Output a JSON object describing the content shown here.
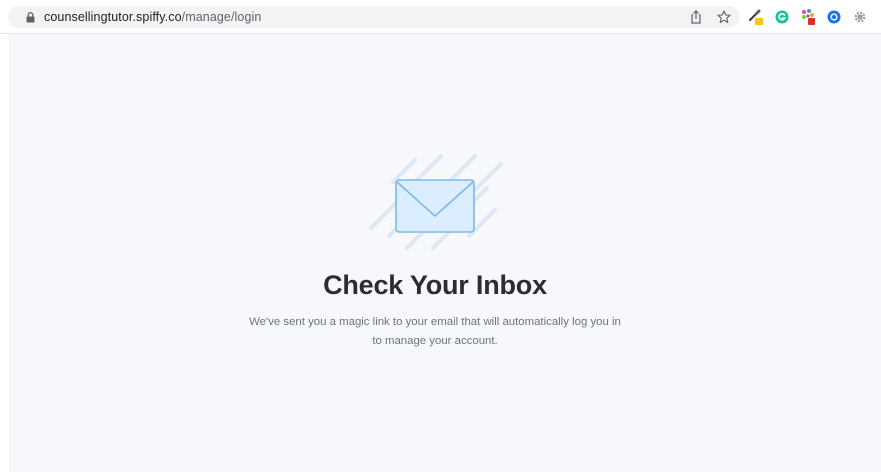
{
  "browser": {
    "url_domain": "counsellingtutor.spiffy.co",
    "url_path": "/manage/login",
    "icons": {
      "lock": "lock-icon",
      "share": "share-icon",
      "bookmark": "bookmark-star-icon"
    },
    "extensions": [
      "eyedropper-extension-icon",
      "grammarly-extension-icon",
      "colorful-extension-icon",
      "blue-circle-extension-icon",
      "gear-extension-icon",
      "puzzle-extensions-icon"
    ]
  },
  "page": {
    "title": "Check Your Inbox",
    "message": "We've sent you a magic link to your email that will automatically log you in to manage your account.",
    "illustration": "envelope-icon"
  },
  "colors": {
    "background": "#f7f8fb",
    "title": "#2b2d31",
    "message": "#6b7280",
    "envelope_fill": "#dbeeff",
    "envelope_stroke": "#7fb8ea",
    "stripe": "#dbe8f6"
  }
}
